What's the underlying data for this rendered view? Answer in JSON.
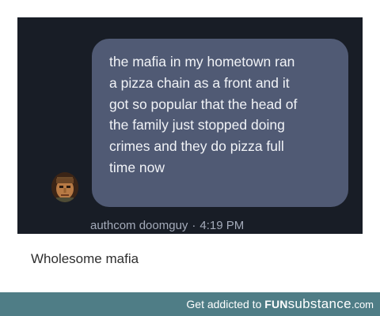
{
  "message": {
    "lines": [
      "the mafia in my hometown ran",
      "a pizza chain as a front and it",
      "got so popular that the head of",
      "the family just stopped doing",
      "crimes and they do pizza full",
      "time now"
    ],
    "author": "authcom doomguy",
    "separator": "·",
    "time": "4:19 PM"
  },
  "caption": "Wholesome mafia",
  "footer": {
    "tagline": "Get addicted to",
    "brand_fun": "FUN",
    "brand_substance": "substance",
    "brand_tld": ".com"
  },
  "colors": {
    "chat_background": "#181d26",
    "bubble": "#505a74",
    "footer_bar": "#4f7d86"
  },
  "icons": {
    "avatar": "doomguy-face-avatar"
  }
}
